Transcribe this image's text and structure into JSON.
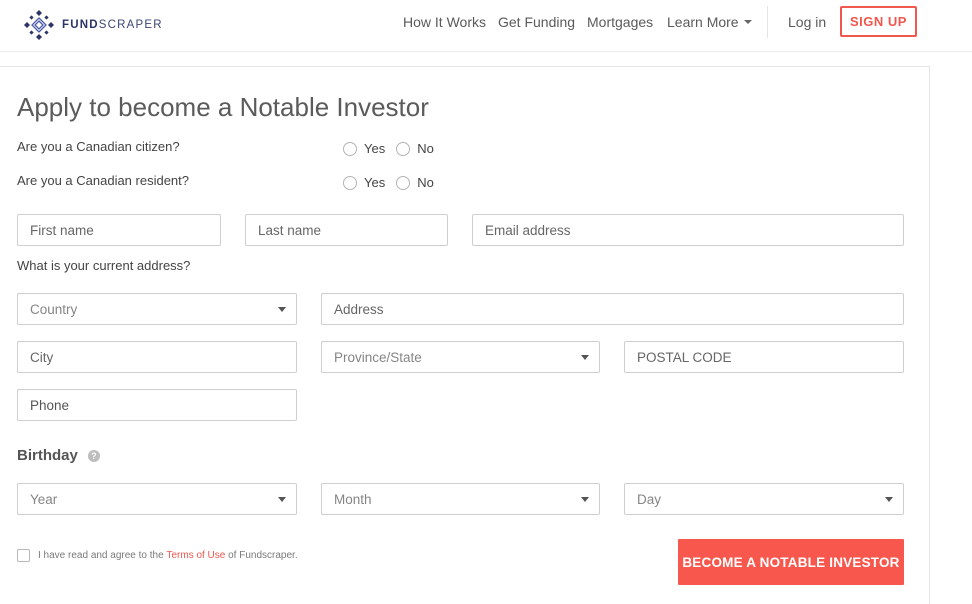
{
  "brand": {
    "name_bold": "FUND",
    "name_light": "SCRAPER",
    "accent": "#f0574d",
    "navy": "#2c3566"
  },
  "nav": {
    "how_it_works": "How It Works",
    "get_funding": "Get Funding",
    "mortgages": "Mortgages",
    "learn_more": "Learn More",
    "login": "Log in",
    "signup": "SIGN UP"
  },
  "form": {
    "title": "Apply to become a Notable Investor",
    "citizen_question": "Are you a Canadian citizen?",
    "resident_question": "Are you a Canadian resident?",
    "yes": "Yes",
    "no": "No",
    "first_name_placeholder": "First name",
    "last_name_placeholder": "Last name",
    "email_placeholder": "Email address",
    "address_question": "What is your current address?",
    "country_select": "Country",
    "address_placeholder": "Address",
    "city_placeholder": "City",
    "province_select": "Province/State",
    "postal_placeholder": "POSTAL CODE",
    "phone_placeholder": "Phone",
    "birthday_label": "Birthday",
    "help_glyph": "?",
    "year_select": "Year",
    "month_select": "Month",
    "day_select": "Day",
    "agree_prefix": "I have read and agree to the ",
    "terms_link": "Terms of Use",
    "agree_suffix": " of Fundscraper.",
    "submit": "BECOME A NOTABLE INVESTOR"
  },
  "icons": {
    "logo": "fundscraper-logo-icon",
    "caret": "chevron-down-icon",
    "help": "help-circle-icon"
  }
}
